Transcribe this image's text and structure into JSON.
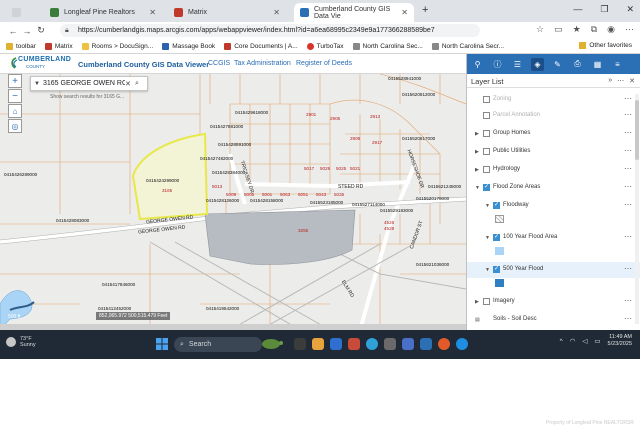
{
  "browser": {
    "tabs": [
      {
        "label": "Longleaf Pine Realtors",
        "active": false,
        "favicon_color": "#3a7d3a"
      },
      {
        "label": "Matrix",
        "active": false,
        "favicon_color": "#c0392b"
      },
      {
        "label": "Cumberland County GIS Data Vie",
        "active": true,
        "favicon_color": "#2b6fb5"
      }
    ],
    "new_tab_label": "+",
    "url": "https://cumberlandgis.maps.arcgis.com/apps/webappviewer/index.html?id=a6ea68995c2349e9a177366288589be7",
    "bookmarks": [
      {
        "label": "toolbar",
        "color": "#e0b030"
      },
      {
        "label": "Matrix",
        "color": "#c0392b"
      },
      {
        "label": "Rooms > DocuSign...",
        "color": "#f0c040"
      },
      {
        "label": "Massage Book",
        "color": "#2a62b0"
      },
      {
        "label": "Core Documents | A...",
        "color": "#c0392b"
      },
      {
        "label": "TurboTax",
        "color": "#d9342b"
      },
      {
        "label": "North Carolina Sec...",
        "color": "#888888"
      },
      {
        "label": "North Carolina Secr...",
        "color": "#888888"
      }
    ],
    "other_favorites": "Other favorites"
  },
  "app": {
    "logo_name": "CUMBERLAND",
    "logo_sub": "COUNTY",
    "title": "Cumberland County GIS Data Viewer",
    "links": [
      "CCGIS",
      "Tax Administration",
      "Register of Deeds"
    ]
  },
  "search": {
    "value": "3165 GEORGE OWEN RO",
    "hint": "Show search results for 3165 G..."
  },
  "map": {
    "parcels": [
      {
        "id": "0415429618000"
      },
      {
        "id": "0415427881000"
      },
      {
        "id": "0415428591000"
      },
      {
        "id": "0415427482000"
      },
      {
        "id": "0415428384000"
      },
      {
        "id": "0415424299000",
        "highlight": true
      },
      {
        "id": "0415426289000"
      },
      {
        "id": "0415428083000"
      },
      {
        "id": "0415428126000"
      },
      {
        "id": "0415428158000"
      },
      {
        "id": "0415523185000"
      },
      {
        "id": "0415527114000"
      },
      {
        "id": "0415529183000"
      },
      {
        "id": "0415520178000"
      },
      {
        "id": "0415621245000"
      },
      {
        "id": "0415621036000"
      },
      {
        "id": "0415620812000"
      },
      {
        "id": "0415520817000"
      },
      {
        "id": "0415528941000"
      },
      {
        "id": "0415417846000"
      },
      {
        "id": "0415412452000"
      },
      {
        "id": "0415419542000"
      }
    ],
    "house_numbers": [
      "3165",
      "3255",
      "2901",
      "2905",
      "2909",
      "2913",
      "2917",
      "5029",
      "5025",
      "5021",
      "5017",
      "5013",
      "5009",
      "5005",
      "5001",
      "5063",
      "5051",
      "5043",
      "5035",
      "4526",
      "4528"
    ],
    "roads": [
      "GEORGE OWEN RD",
      "GEORGE OWEN RD",
      "STEED RD",
      "ELM RD",
      "TRICKSEY DR",
      "HORSESHOE DR",
      "CANDOR ST"
    ],
    "coord_readout": "852,065.972 500,515.479 Feet",
    "scale": "500 ft"
  },
  "layers": {
    "title": "Layer List",
    "items": [
      {
        "label": "Zoning",
        "checked": false,
        "indent": 0,
        "expand": "none",
        "faded": true
      },
      {
        "label": "Parcel Annotation",
        "checked": false,
        "indent": 0,
        "expand": "none",
        "faded": true
      },
      {
        "label": "Group Homes",
        "checked": false,
        "indent": 0,
        "expand": "collapsed"
      },
      {
        "label": "Public Utilities",
        "checked": false,
        "indent": 0,
        "expand": "collapsed"
      },
      {
        "label": "Hydrology",
        "checked": false,
        "indent": 0,
        "expand": "collapsed"
      },
      {
        "label": "Flood Zone Areas",
        "checked": true,
        "indent": 0,
        "expand": "expanded"
      },
      {
        "label": "Floodway",
        "checked": true,
        "indent": 1,
        "expand": "expanded",
        "swatch": "hatch"
      },
      {
        "label": "100 Year Flood Area",
        "checked": true,
        "indent": 1,
        "expand": "expanded",
        "swatch": "#a9d4f5"
      },
      {
        "label": "500 Year Flood",
        "checked": true,
        "indent": 1,
        "expand": "expanded",
        "swatch": "#2f7fc1",
        "highlight": true
      },
      {
        "label": "Imagery",
        "checked": false,
        "indent": 0,
        "expand": "collapsed"
      },
      {
        "label": "Soils - Soil Desc",
        "checked": false,
        "indent": 0,
        "expand": "none",
        "icon": "table"
      }
    ]
  },
  "taskbar": {
    "weather_temp": "73°F",
    "weather_desc": "Sunny",
    "search_label": "Search",
    "time": "11:49 AM",
    "date": "5/23/2025"
  },
  "credit": "Property of Longleaf Pine REALTORS®",
  "colors": {
    "accent": "#2b6fb5",
    "parcel_line": "#e0a060",
    "selection": "#e8e84a",
    "flood_gray": "#b7bcc2"
  }
}
